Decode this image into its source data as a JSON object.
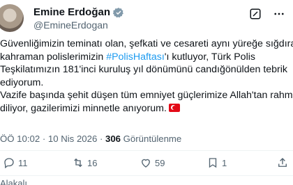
{
  "author": {
    "name": "Emine Erdoğan",
    "handle": "@EmineErdogan"
  },
  "tweet": {
    "lines_p1": [
      "Güvenliğimizin teminatı olan, şefkati ve cesareti aynı yüreğe sığdıran",
      "kahraman polislerimizin ",
      "'ı kutluyor, Türk Polis",
      "Teşkilatımızın 181'inci kuruluş yıl dönümünü candığönülden tebrik",
      "ediyorum."
    ],
    "hashtag": "#PolisHaftası",
    "lines_p2": [
      "Vazife başında şehit düşen tüm emniyet güçlerimize Allah'tan rahmet",
      "diliyor, gazilerimizi minnetle anıyorum."
    ]
  },
  "meta": {
    "time": "ÖÖ 10:02 · 10 Nis 2026 · ",
    "views_count": "306",
    "views_label": " Görüntülenme"
  },
  "actions": {
    "reply_count": "11",
    "retweet_count": "16",
    "like_count": "59",
    "bookmark_count": "1"
  },
  "related_label": "Alakalı"
}
